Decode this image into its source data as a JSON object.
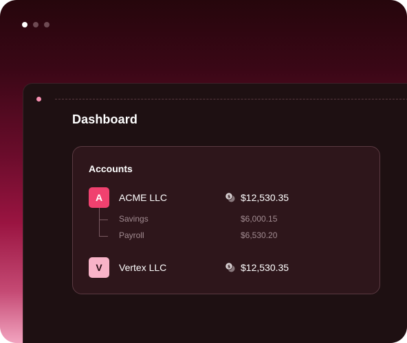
{
  "window": {
    "dots": [
      "active",
      "inactive",
      "inactive"
    ]
  },
  "dashboard": {
    "title": "Dashboard"
  },
  "accounts": {
    "title": "Accounts",
    "items": [
      {
        "initial": "A",
        "name": "ACME LLC",
        "amount": "$12,530.35",
        "icon": "coins-icon",
        "sub_accounts": [
          {
            "name": "Savings",
            "amount": "$6,000.15"
          },
          {
            "name": "Payroll",
            "amount": "$6,530.20"
          }
        ]
      },
      {
        "initial": "V",
        "name": "Vertex LLC",
        "amount": "$12,530.35",
        "icon": "coins-icon",
        "sub_accounts": []
      }
    ]
  },
  "colors": {
    "acme_avatar": "#f0416f",
    "vertex_avatar": "#f8b3c8",
    "indicator_dot": "#f58fb0"
  }
}
